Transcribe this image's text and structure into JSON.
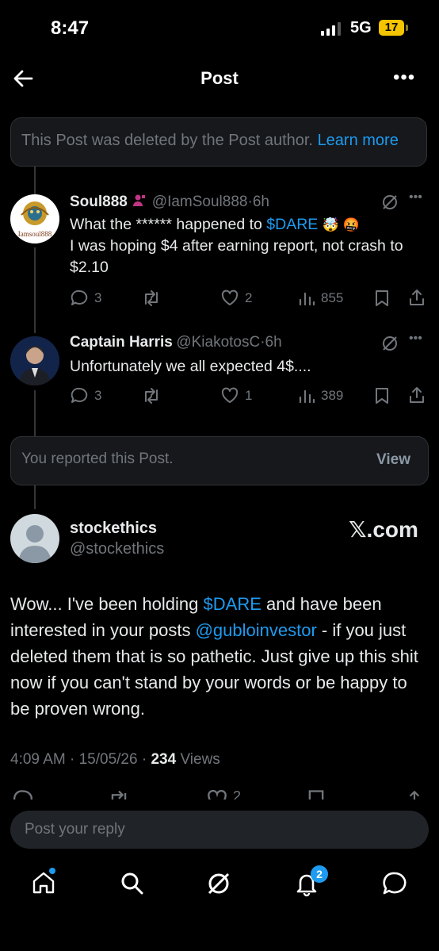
{
  "status_bar": {
    "time": "8:47",
    "network": "5G",
    "battery": "17"
  },
  "header": {
    "title": "Post"
  },
  "deleted_notice": {
    "text": "This Post was deleted by the Post author.",
    "link": "Learn more"
  },
  "replies": [
    {
      "name": "Soul888",
      "handle": "@IamSoul888",
      "time": "6h",
      "avatar_text": "Iamsoul888",
      "line1_prefix": "What the ****** happened to ",
      "cashtag": "$DARE",
      "emojis": "🤯 🤬",
      "line2": "I was hoping $4 after earning report, not crash to $2.10",
      "replies": "3",
      "likes": "2",
      "views": "855"
    },
    {
      "name": "Captain Harris",
      "handle": "@KiakotosC",
      "time": "6h",
      "text": "Unfortunately we all expected 4$....",
      "replies": "3",
      "likes": "1",
      "views": "389"
    }
  ],
  "reported_notice": {
    "text": "You reported this Post.",
    "button": "View"
  },
  "main_post": {
    "name": "stockethics",
    "handle": "@stockethics",
    "badge": "𝕏.com",
    "text_part1": "Wow... I've been holding ",
    "cashtag": "$DARE",
    "text_part2": " and have been interested in your posts ",
    "mention": "@gubloinvestor",
    "text_part3": " - if you just deleted them that is so pathetic.  Just give up this shit now if you can't stand by your words or be happy to be proven wrong.",
    "time": "4:09 AM",
    "date": "15/05/26",
    "views_count": "234",
    "views_label": "Views",
    "likes_partial": "2"
  },
  "reply_input": {
    "placeholder": "Post your reply"
  },
  "tab_bar": {
    "notifications_badge": "2"
  },
  "colors": {
    "accent": "#1d9bf0",
    "background": "#000000",
    "muted": "#71767b"
  }
}
